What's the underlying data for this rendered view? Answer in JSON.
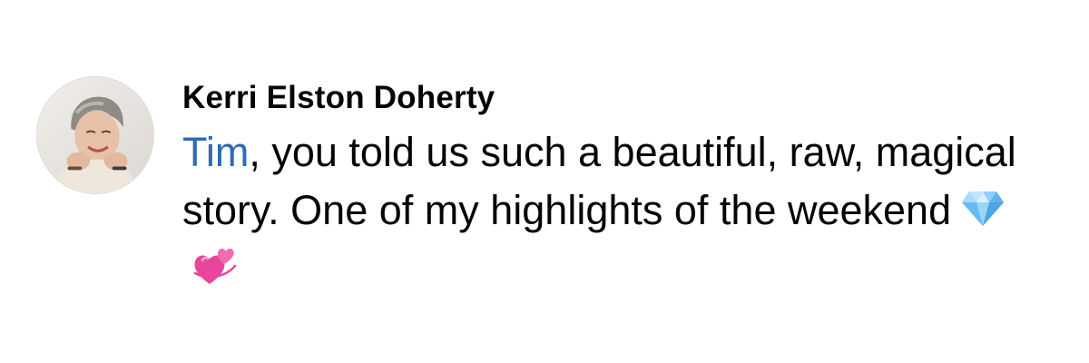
{
  "comment": {
    "author_name": "Kerri Elston Doherty",
    "mention": "Tim",
    "text_after_mention": ", you told us such a beautiful, raw, magical story. One of my highlights of the weekend",
    "reactions": [
      "gem-stone-icon",
      "revolving-hearts-icon"
    ],
    "mention_color": "#2b6cb5"
  }
}
